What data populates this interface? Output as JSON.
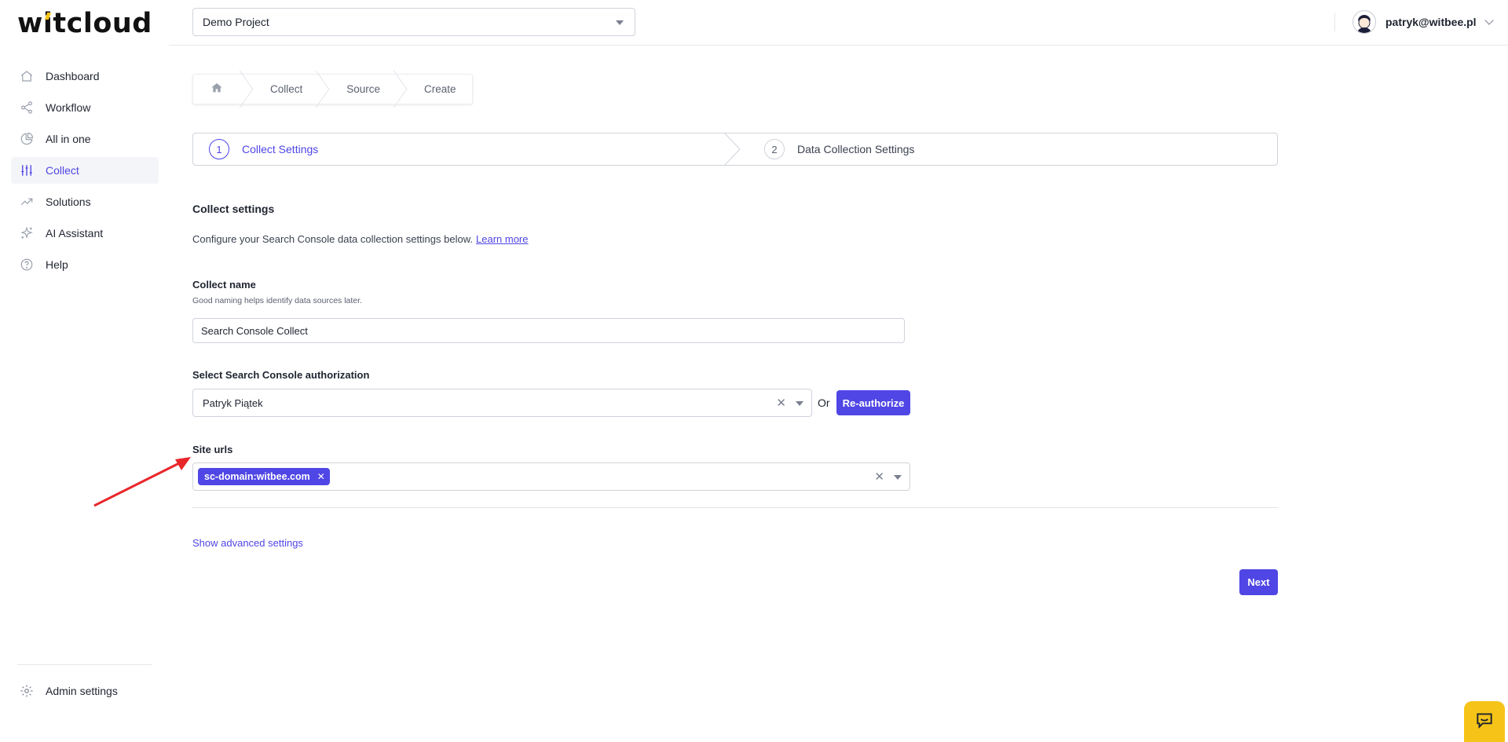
{
  "brand": {
    "logo_text_before": "w",
    "logo_text_i": "i",
    "logo_text_after": "tcloud",
    "accent": "#4f46e5",
    "logo_accent": "#f6c418"
  },
  "sidebar": {
    "items": [
      {
        "label": "Dashboard",
        "icon": "home-icon",
        "active": false
      },
      {
        "label": "Workflow",
        "icon": "share-icon",
        "active": false
      },
      {
        "label": "All in one",
        "icon": "pie-chart-icon",
        "active": false
      },
      {
        "label": "Collect",
        "icon": "sliders-icon",
        "active": true
      },
      {
        "label": "Solutions",
        "icon": "trending-up-icon",
        "active": false
      },
      {
        "label": "AI Assistant",
        "icon": "sparkles-icon",
        "active": false
      },
      {
        "label": "Help",
        "icon": "question-circle-icon",
        "active": false
      }
    ],
    "admin_label": "Admin settings"
  },
  "header": {
    "project": "Demo Project",
    "user_email": "patryk@witbee.pl"
  },
  "breadcrumb": {
    "items": [
      "Collect",
      "Source",
      "Create"
    ]
  },
  "steps": [
    {
      "number": "1",
      "label": "Collect Settings",
      "active": true
    },
    {
      "number": "2",
      "label": "Data Collection Settings",
      "active": false
    }
  ],
  "form": {
    "title": "Collect settings",
    "description": "Configure your Search Console data collection settings below.",
    "learn_more": "Learn more",
    "collect_name": {
      "label": "Collect name",
      "hint": "Good naming helps identify data sources later.",
      "value": "Search Console Collect"
    },
    "authorization": {
      "label": "Select Search Console authorization",
      "value": "Patryk Piątek",
      "or_text": "Or",
      "reauthorize": "Re-authorize"
    },
    "site_urls": {
      "label": "Site urls",
      "tags": [
        "sc-domain:witbee.com"
      ]
    },
    "advanced": "Show advanced settings",
    "next": "Next"
  }
}
